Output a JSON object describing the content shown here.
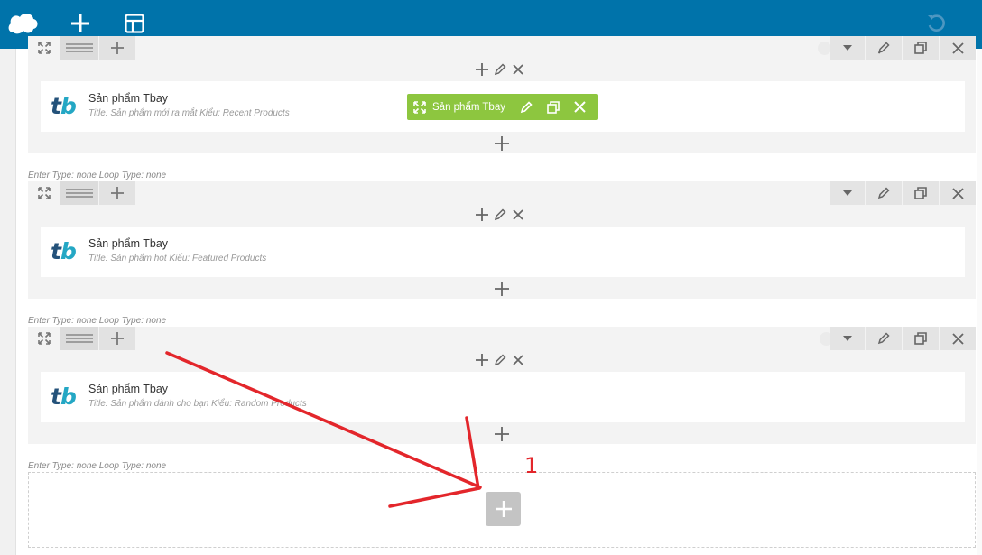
{
  "toolbar": {
    "logo_icon": "cloud-logo-icon",
    "add_icon": "plus-icon",
    "layout_icon": "layout-icon",
    "undo_icon": "undo-icon",
    "bg_color": "#0073aa"
  },
  "rows": [
    {
      "meta": "",
      "element": {
        "name": "Sản phẩm Tbay",
        "meta": "Title: Sản phẩm mới ra mắt  Kiểu: Recent Products"
      }
    },
    {
      "meta": "Enter Type: none  Loop Type: none",
      "element": {
        "name": "Sản phẩm Tbay",
        "meta": "Title: Sản phẩm hot  Kiểu: Featured Products"
      }
    },
    {
      "meta": "Enter Type: none  Loop Type: none",
      "element": {
        "name": "Sản phẩm Tbay",
        "meta": "Title: Sản phẩm dành cho bạn  Kiểu: Random Products"
      }
    }
  ],
  "empty_row": {
    "meta": "Enter Type: none  Loop Type: none"
  },
  "hover_toolbar": {
    "label": "Sản phẩm Tbay",
    "color": "#8dc63f"
  },
  "annotation": {
    "number": "1",
    "color": "#e3262b"
  }
}
